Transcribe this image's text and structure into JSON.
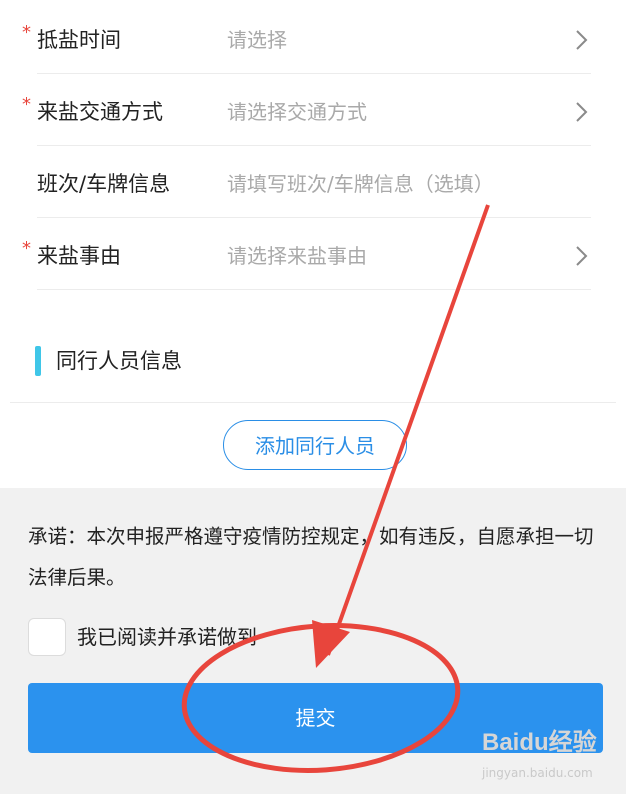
{
  "form": {
    "rows": [
      {
        "required": "*",
        "label": "抵盐时间",
        "value": "请选择",
        "has_chevron": true
      },
      {
        "required": "*",
        "label": "来盐交通方式",
        "value": "请选择交通方式",
        "has_chevron": true
      },
      {
        "required": "",
        "label": "班次/车牌信息",
        "value": "请填写班次/车牌信息（选填）",
        "has_chevron": false
      },
      {
        "required": "*",
        "label": "来盐事由",
        "value": "请选择来盐事由",
        "has_chevron": true
      }
    ],
    "chevron_icon": "chevron-right-icon"
  },
  "section": {
    "title": "同行人员信息",
    "accent_color": "#3fc6e8"
  },
  "add_companion_button": "添加同行人员",
  "footer": {
    "promise_text": "承诺：本次申报严格遵守疫情防控规定，如有违反，自愿承担一切法律后果。",
    "agree_label": "我已阅读并承诺做到",
    "checkbox_checked": false,
    "submit_label": "提交"
  },
  "watermark": {
    "logo": "Baidu经验",
    "url": "jingyan.baidu.com"
  },
  "colors": {
    "primary": "#2b92ee",
    "required": "#e8453c",
    "annotation": "#e8453c"
  }
}
